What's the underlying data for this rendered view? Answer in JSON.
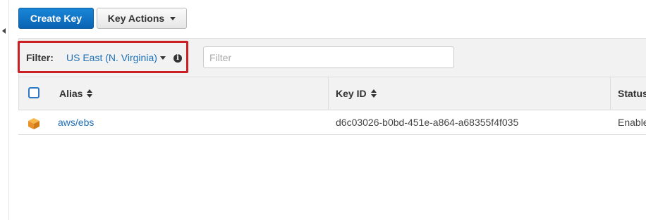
{
  "toolbar": {
    "create_key_label": "Create Key",
    "key_actions_label": "Key Actions"
  },
  "filter": {
    "label": "Filter:",
    "region": "US East (N. Virginia)",
    "search_placeholder": "Filter",
    "search_value": ""
  },
  "table": {
    "columns": [
      "Alias",
      "Key ID",
      "Status"
    ],
    "rows": [
      {
        "alias": "aws/ebs",
        "key_id": "d6c03026-b0bd-451e-a864-a68355f4f035",
        "status": "Enable"
      }
    ]
  },
  "colors": {
    "primary_button": "#0a63b4",
    "highlight_border": "#cc1f24",
    "link": "#1d6fb8",
    "key_icon": "#f0a020"
  },
  "icons": {
    "sidebar_toggle": "caret-left-icon",
    "info": "info-icon",
    "sort": "sort-icon",
    "key": "cube-icon"
  }
}
